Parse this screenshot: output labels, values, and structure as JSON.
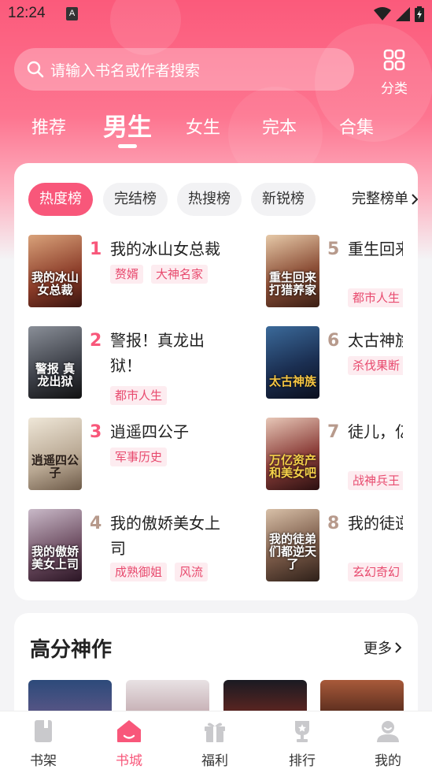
{
  "status": {
    "time": "12:24",
    "notif_badge": "A"
  },
  "search": {
    "placeholder": "请输入书名或作者搜索"
  },
  "category": {
    "label": "分类"
  },
  "tabs": [
    {
      "label": "推荐"
    },
    {
      "label": "男生",
      "active": true
    },
    {
      "label": "女生"
    },
    {
      "label": "完本"
    },
    {
      "label": "合集"
    }
  ],
  "rank_chips": [
    {
      "label": "热度榜",
      "active": true
    },
    {
      "label": "完结榜"
    },
    {
      "label": "热搜榜"
    },
    {
      "label": "新锐榜"
    }
  ],
  "full_list_label": "完整榜单",
  "books": [
    {
      "rank": "1",
      "title": "我的冰山女总裁",
      "tags": [
        "赘婿",
        "大神名家"
      ],
      "cover_text": "我的冰山女总裁"
    },
    {
      "rank": "2",
      "title": "警报！真龙出\n狱！",
      "tags": [
        "都市人生"
      ],
      "cover_text": "警报 真龙出狱"
    },
    {
      "rank": "3",
      "title": "逍遥四公子",
      "tags": [
        "军事历史"
      ],
      "cover_text": "逍遥四公子"
    },
    {
      "rank": "4",
      "title": "我的傲娇美女上\n司",
      "tags": [
        "成熟御姐",
        "风流"
      ],
      "cover_text": "我的傲娇美女上司"
    },
    {
      "rank": "5",
      "title": "重生回来养家，",
      "tags": [
        "都市人生"
      ],
      "cover_text": "重生回来打猎养家"
    },
    {
      "rank": "6",
      "title": "太古神族",
      "tags": [
        "杀伐果断"
      ],
      "cover_text": "太古神族"
    },
    {
      "rank": "7",
      "title": "徒儿，亿资产",
      "tags": [
        "战神兵王"
      ],
      "cover_text": "万亿资产和美女吧"
    },
    {
      "rank": "8",
      "title": "我的徒逆天了",
      "tags": [
        "玄幻奇幻"
      ],
      "cover_text": "我的徒弟们都逆天了"
    }
  ],
  "high_score": {
    "title": "高分神作",
    "more_label": "更多"
  },
  "bottom_nav": [
    {
      "label": "书架",
      "icon": "book-icon"
    },
    {
      "label": "书城",
      "icon": "home-icon",
      "active": true
    },
    {
      "label": "福利",
      "icon": "gift-icon"
    },
    {
      "label": "排行",
      "icon": "trophy-icon"
    },
    {
      "label": "我的",
      "icon": "user-icon"
    }
  ],
  "colors": {
    "accent": "#f8577a",
    "tag_bg": "#fdecf0",
    "tag_text": "#e84a6e",
    "rank_top": "#f8577a",
    "rank_other": "#b79a8c"
  }
}
